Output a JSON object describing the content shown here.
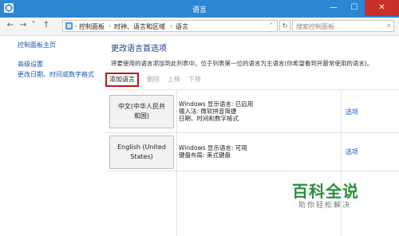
{
  "window": {
    "title": "语言",
    "minimize": "—",
    "maximize": "☐",
    "close": "✕"
  },
  "nav": {
    "back": "←",
    "forward": "→",
    "recent": "˅",
    "up": "↑"
  },
  "address": {
    "breadcrumbs": [
      "控制面板",
      "时钟、语言和区域",
      "语言"
    ],
    "separator": "›",
    "refresh": "↻"
  },
  "search": {
    "placeholder": "搜索控制面板",
    "icon": "⌕"
  },
  "sidebar": {
    "links": [
      "控制面板主页",
      "高级设置",
      "更改日期、时间或数字格式"
    ]
  },
  "main": {
    "heading": "更改语言首选项",
    "description": "将要使用的语言添加到此列表中。位于列表第一位的语言为主语言(你希望看到并最常使用的语言)。",
    "toolbar": {
      "add": "添加语言",
      "remove": "删除",
      "move_up": "上移",
      "move_down": "下移"
    },
    "languages": [
      {
        "name_line1": "中文(中华人民共",
        "name_line2": "和国)",
        "info": [
          "Windows 显示语言: 已启用",
          "输入法: 微软拼音简捷",
          "日期、时间和数字格式"
        ],
        "options": "选项"
      },
      {
        "name_line1": "English (United",
        "name_line2": "States)",
        "info": [
          "Windows 显示语言: 可用",
          "键盘布局: 美式键盘"
        ],
        "options": "选项"
      }
    ]
  },
  "watermark": {
    "logo": "百科全说",
    "sub": "助你轻松解决"
  },
  "colors": {
    "titlebar": "#2b86d3",
    "close": "#c7302b",
    "link": "#1c56b7",
    "heading": "#1e3d86",
    "highlight_border": "#b51c1c"
  }
}
